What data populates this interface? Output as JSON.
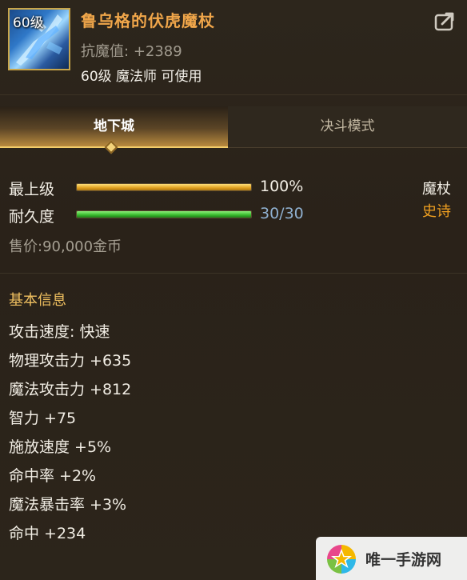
{
  "item": {
    "level_tag": "60级",
    "name": "鲁乌格的伏虎魔杖",
    "resist_label": "抗魔值:",
    "resist_value": "+2389",
    "usable": "60级 魔法师 可使用",
    "icon": "ice-staff-icon"
  },
  "header": {
    "share_icon": "share-icon"
  },
  "tabs": [
    {
      "label": "地下城",
      "active": true
    },
    {
      "label": "决斗模式",
      "active": false
    }
  ],
  "status": {
    "upgrade_label": "最上级",
    "upgrade_percent": 100,
    "upgrade_value": "100%",
    "durability_label": "耐久度",
    "durability_current": 30,
    "durability_max": 30,
    "durability_value": "30/30",
    "weapon_type": "魔杖",
    "rarity": "史诗",
    "price_label": "售价:",
    "price_value": "90,000金币"
  },
  "basic_info": {
    "title": "基本信息",
    "stats": [
      "攻击速度: 快速",
      "物理攻击力 +635",
      "魔法攻击力 +812",
      "智力 +75",
      "施放速度 +5%",
      "命中率 +2%",
      "魔法暴击率 +3%",
      "命中 +234"
    ]
  },
  "watermark": {
    "text": "唯一手游网",
    "icon": "star-logo-icon"
  },
  "colors": {
    "item_name": "#f0a64a",
    "rarity": "#f0a020",
    "section_title": "#f0c060",
    "durability_value": "#8fb0d0"
  }
}
